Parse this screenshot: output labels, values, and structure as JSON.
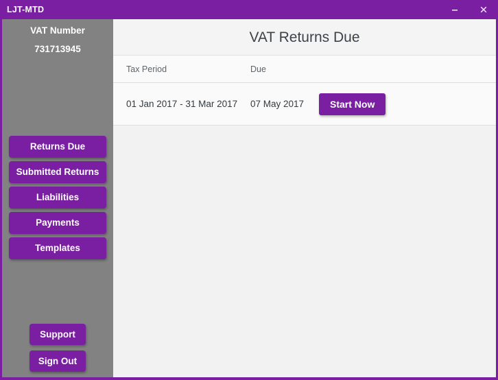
{
  "window": {
    "title": "LJT-MTD",
    "accent_color": "#7b1fa2",
    "sidebar_color": "#828282",
    "controls": {
      "minimize_label": "–",
      "minimize_icon": "minimize-icon",
      "close_label": "✕",
      "close_icon": "close-icon"
    }
  },
  "sidebar": {
    "vat_label": "VAT Number",
    "vat_number": "731713945",
    "nav_items": [
      {
        "label": "Returns Due"
      },
      {
        "label": "Submitted Returns"
      },
      {
        "label": "Liabilities"
      },
      {
        "label": "Payments"
      },
      {
        "label": "Templates"
      }
    ],
    "actions": [
      {
        "label": "Support"
      },
      {
        "label": "Sign Out"
      }
    ]
  },
  "main": {
    "page_title": "VAT Returns Due",
    "table": {
      "columns": [
        "Tax Period",
        "Due",
        ""
      ],
      "rows": [
        {
          "tax_period": "01 Jan 2017 - 31 Mar 2017",
          "due": "07 May 2017",
          "action_label": "Start Now"
        }
      ]
    }
  }
}
